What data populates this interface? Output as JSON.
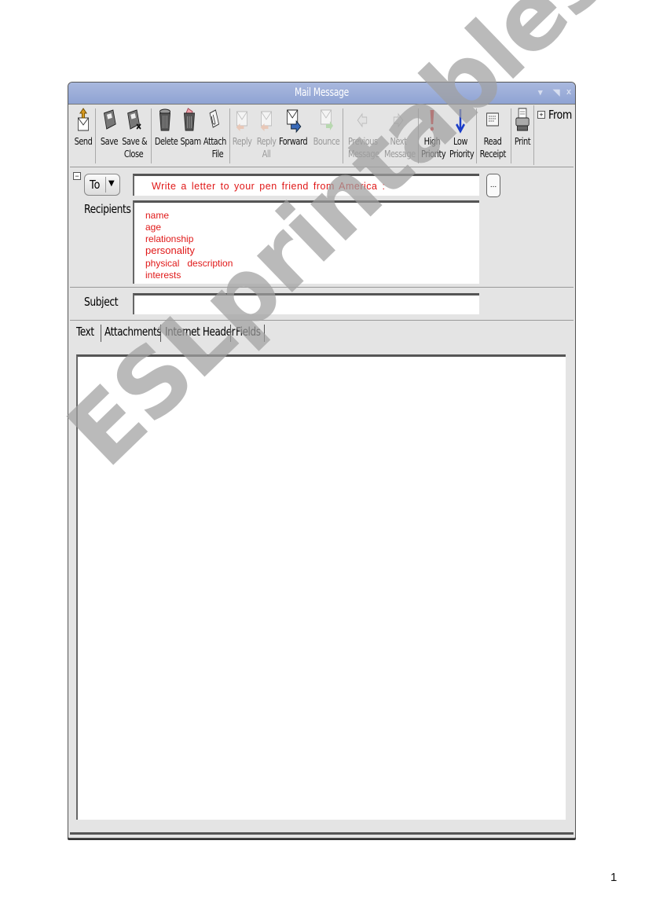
{
  "window": {
    "title": "Mail Message",
    "controls": [
      "▾",
      "◥",
      "x"
    ]
  },
  "toolbar": {
    "buttons": [
      {
        "id": "send",
        "lines": [
          "Send",
          ""
        ],
        "icon": "send-icon",
        "enabled": true
      },
      {
        "id": "save",
        "lines": [
          "Save",
          ""
        ],
        "icon": "save-icon",
        "enabled": true
      },
      {
        "id": "save-close",
        "lines": [
          "Save &",
          "Close"
        ],
        "icon": "save-close-icon",
        "enabled": true
      },
      {
        "id": "delete",
        "lines": [
          "Delete",
          ""
        ],
        "icon": "trash-icon",
        "enabled": true
      },
      {
        "id": "spam",
        "lines": [
          "Spam",
          ""
        ],
        "icon": "spam-trash-icon",
        "enabled": true
      },
      {
        "id": "attach",
        "lines": [
          "Attach",
          "File"
        ],
        "icon": "paperclip-icon",
        "enabled": true
      },
      {
        "id": "reply",
        "lines": [
          "Reply",
          ""
        ],
        "icon": "reply-icon",
        "enabled": false
      },
      {
        "id": "reply-all",
        "lines": [
          "Reply",
          "All"
        ],
        "icon": "reply-all-icon",
        "enabled": false
      },
      {
        "id": "forward",
        "lines": [
          "Forward",
          ""
        ],
        "icon": "forward-icon",
        "enabled": true
      },
      {
        "id": "bounce",
        "lines": [
          "Bounce",
          ""
        ],
        "icon": "bounce-icon",
        "enabled": false
      },
      {
        "id": "previous",
        "lines": [
          "Previous",
          "Message"
        ],
        "icon": "arrow-left-icon",
        "enabled": false
      },
      {
        "id": "next",
        "lines": [
          "Next",
          "Message"
        ],
        "icon": "arrow-right-icon",
        "enabled": false
      },
      {
        "id": "high-priority",
        "lines": [
          "High",
          "Priority"
        ],
        "icon": "exclamation-icon",
        "enabled": true
      },
      {
        "id": "low-priority",
        "lines": [
          "Low",
          "Priority"
        ],
        "icon": "arrow-down-icon",
        "enabled": true
      },
      {
        "id": "read-receipt",
        "lines": [
          "Read",
          "Receipt"
        ],
        "icon": "receipt-icon",
        "enabled": true
      },
      {
        "id": "print",
        "lines": [
          "Print",
          ""
        ],
        "icon": "printer-icon",
        "enabled": true
      }
    ],
    "from_label": "From"
  },
  "recipients": {
    "to_label": "To",
    "to_value": "Write a letter to your pen friend from America :",
    "ellipsis_label": "...",
    "label": "Recipients",
    "lines": [
      "name",
      "age",
      "relationship",
      "personality",
      "physical   description",
      "interests"
    ]
  },
  "subject": {
    "label": "Subject",
    "value": ""
  },
  "tabs": [
    "Text",
    "Attachments",
    "Internet Header",
    "Fields"
  ],
  "body": {
    "value": ""
  },
  "colors": {
    "instruction_text": "#e01818",
    "titlebar": "#9aacd8",
    "high_priority": "#e01818",
    "low_priority": "#1a3cc8"
  },
  "watermark": "ESLprintables.com",
  "page_number": "1"
}
